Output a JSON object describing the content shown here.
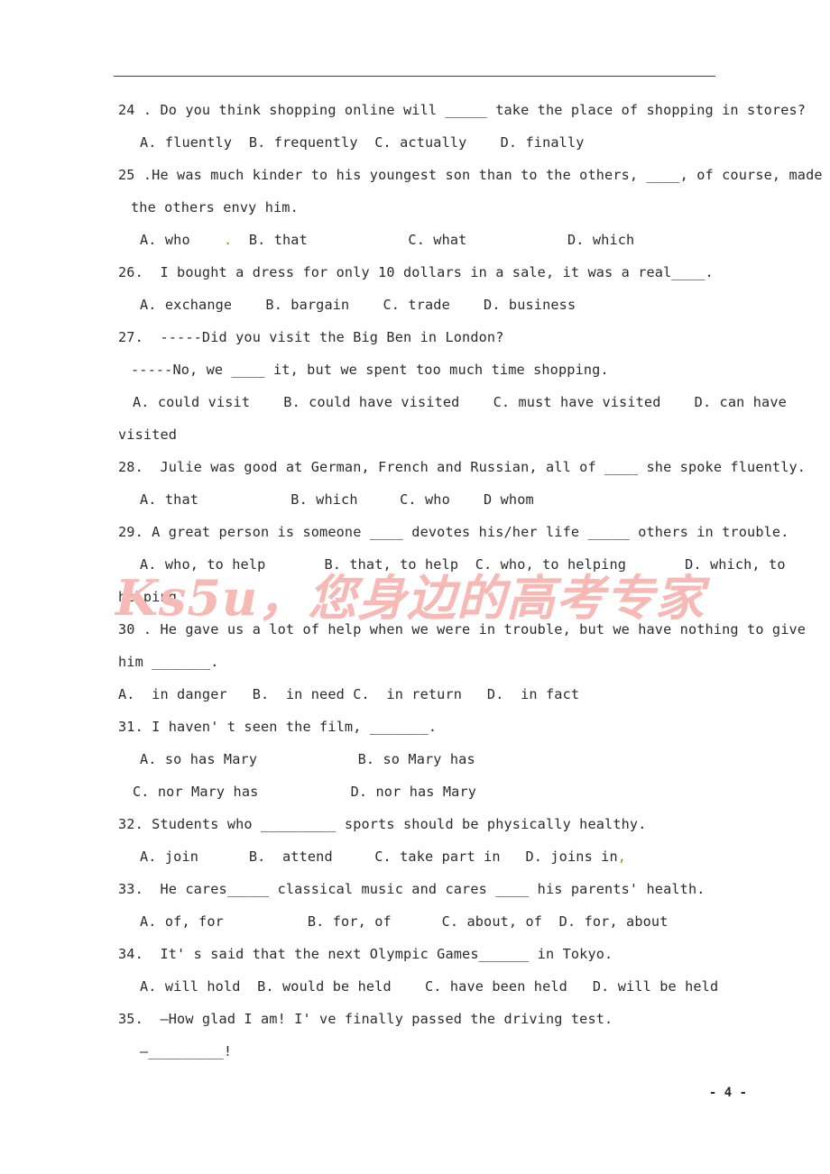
{
  "document": {
    "page_number": "- 4 -",
    "watermark": "Ks5u，您身边的高考专家",
    "watermark_color": "#f6b9b6",
    "text_color": "#2b2b2b",
    "stray_mark_color": "#9a8b18"
  },
  "lines": {
    "l01": "24 . Do you think shopping online will _____ take the place of shopping in stores?",
    "l02": "A. fluently  B. frequently  C. actually    D. finally",
    "l03": "25 .He was much kinder to his youngest son than to the others, ____, of course, made",
    "l04": "the others envy him.",
    "l05a": "A. who",
    "l05stray": ".",
    "l05b": "B. that            C. what            D. which",
    "l06": "26.  I bought a dress for only 10 dollars in a sale, it was a real____.",
    "l07": "A. exchange    B. bargain    C. trade    D. business",
    "l08": "27.  -----Did you visit the Big Ben in London?",
    "l09": "-----No, we ____ it, but we spent too much time shopping.",
    "l10": "A. could visit    B. could have visited    C. must have visited    D. can have",
    "l11": "visited",
    "l12": "28.  Julie was good at German, French and Russian, all of ____ she spoke fluently.",
    "l13": "A. that           B. which     C. who    D whom",
    "l14": "29. A great person is someone ____ devotes his/her life _____ others in trouble.",
    "l15": "A. who, to help       B. that, to help  C. who, to helping       D. which, to",
    "l16": "helping",
    "l17": "30 . He gave us a lot of help when we were in trouble, but we have nothing to give",
    "l18": "him _______.",
    "l19": "A.  in danger   B.  in need C.  in return   D.  in fact",
    "l20": "31. I haven' t seen the film, _______.",
    "l21": "A. so has Mary            B. so Mary has",
    "l22": "C. nor Mary has           D. nor has Mary",
    "l23": "32. Students who _________ sports should be physically healthy.",
    "l24a": "A. join      B.  attend     C. take part in   D. joins in",
    "l24stray": ",",
    "l25": "33.  He cares_____ classical music and cares ____ his parents' health.",
    "l26": "A. of, for          B. for, of      C. about, of  D. for, about",
    "l27": "34.  It' s said that the next Olympic Games______ in Tokyo.",
    "l28": "A. will hold  B. would be held    C. have been held   D. will be held",
    "l29": "35.  —How glad I am! I' ve finally passed the driving test.",
    "l30": "—_________!"
  },
  "questions": [
    {
      "number": "24",
      "stem": "24 . Do you think shopping online will _____ take the place of shopping in stores?",
      "options": [
        "A. fluently",
        "B. frequently",
        "C. actually",
        "D. finally"
      ]
    },
    {
      "number": "25",
      "stem": "25 .He was much kinder to his youngest son than to the others, ____, of course, made the others envy him.",
      "options": [
        "A. who",
        "B. that",
        "C. what",
        "D. which"
      ]
    },
    {
      "number": "26",
      "stem": "26.  I bought a dress for only 10 dollars in a sale, it was a real____.",
      "options": [
        "A. exchange",
        "B. bargain",
        "C. trade",
        "D. business"
      ]
    },
    {
      "number": "27",
      "stem": "27.  -----Did you visit the Big Ben in London? -----No, we ____ it, but we spent too much time shopping.",
      "options": [
        "A. could visit",
        "B. could have visited",
        "C. must have visited",
        "D. can have visited"
      ]
    },
    {
      "number": "28",
      "stem": "28.  Julie was good at German, French and Russian, all of ____ she spoke fluently.",
      "options": [
        "A. that",
        "B. which",
        "C. who",
        "D whom"
      ]
    },
    {
      "number": "29",
      "stem": "29. A great person is someone ____ devotes his/her life _____ others in trouble.",
      "options": [
        "A. who, to help",
        "B. that, to help",
        "C. who, to helping",
        "D. which, to helping"
      ]
    },
    {
      "number": "30",
      "stem": "30 . He gave us a lot of help when we were in trouble, but we have nothing to give him _______.",
      "options": [
        "A.  in danger",
        "B.  in need",
        "C.  in return",
        "D.  in fact"
      ]
    },
    {
      "number": "31",
      "stem": "31. I haven' t seen the film, _______.",
      "options": [
        "A. so has Mary",
        "B. so Mary has",
        "C. nor Mary has",
        "D. nor has Mary"
      ]
    },
    {
      "number": "32",
      "stem": "32. Students who _________ sports should be physically healthy.",
      "options": [
        "A. join",
        "B.  attend",
        "C. take part in",
        "D. joins in"
      ]
    },
    {
      "number": "33",
      "stem": "33.  He cares_____ classical music and cares ____ his parents' health.",
      "options": [
        "A. of, for",
        "B. for, of",
        "C. about, of",
        "D. for, about"
      ]
    },
    {
      "number": "34",
      "stem": "34.  It' s said that the next Olympic Games______ in Tokyo.",
      "options": [
        "A. will hold",
        "B. would be held",
        "C. have been held",
        "D. will be held"
      ]
    },
    {
      "number": "35",
      "stem": "35.  —How glad I am! I' ve finally passed the driving test. —_________!",
      "options": []
    }
  ]
}
